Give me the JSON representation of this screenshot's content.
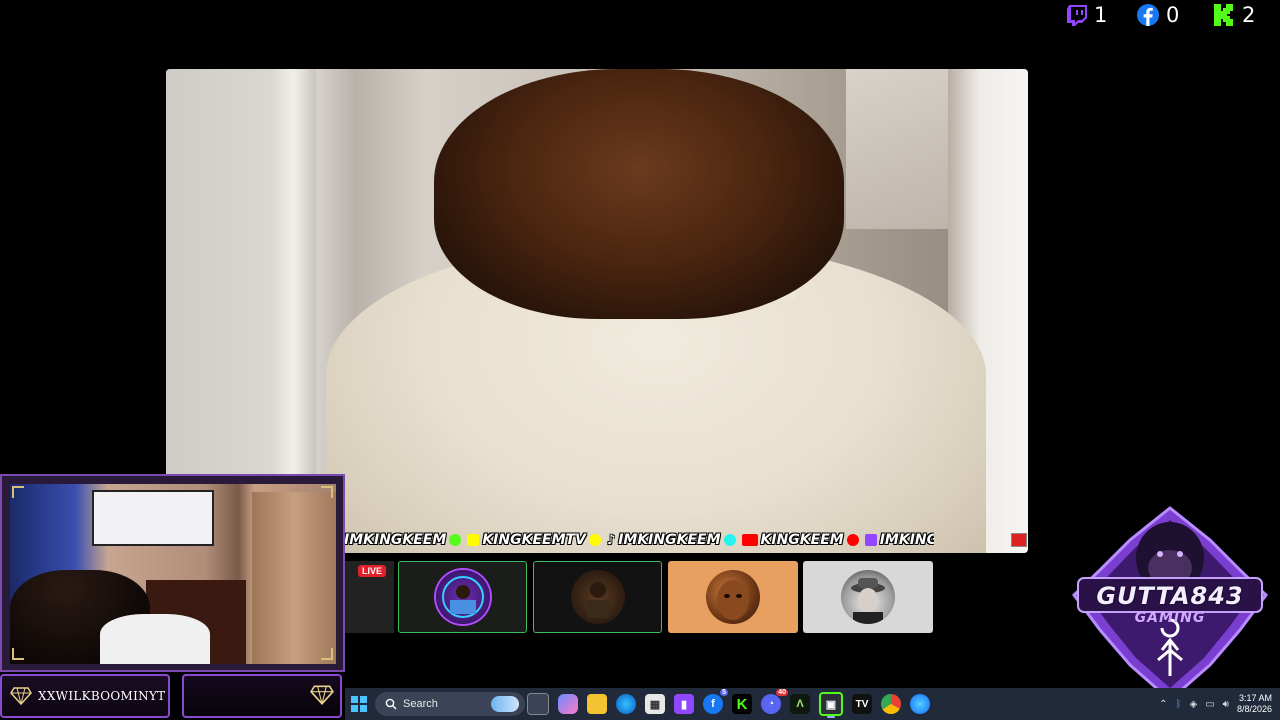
{
  "counters": [
    {
      "platform": "twitch",
      "icon": "twitch-icon",
      "count": "1"
    },
    {
      "platform": "facebook",
      "icon": "facebook-icon",
      "count": "0"
    },
    {
      "platform": "kick",
      "icon": "kick-icon",
      "count": "2"
    }
  ],
  "ticker": [
    {
      "icon": "kick-icon",
      "text": "IMKINGKEEM"
    },
    {
      "icon": "snapchat-icon",
      "text": "KINGKEEMTV"
    },
    {
      "icon": "tiktok-icon",
      "text": "IMKINGKEEM"
    },
    {
      "icon": "youtube-icon",
      "text": "KINGKEEM"
    },
    {
      "icon": "twitch-icon",
      "text": "IMKINGKEEM"
    }
  ],
  "live_badge": "LIVE",
  "webcam": {
    "name": "XXWILKBOOMINYT"
  },
  "logo": {
    "line1": "GUTTA843",
    "line2": "GAMING"
  },
  "taskbar": {
    "search_label": "Search",
    "clock_time": "3:17 AM",
    "clock_date": "8/8/2026",
    "discord_badge": "40",
    "facebook_badge": "5"
  },
  "colors": {
    "twitch": "#9146FF",
    "facebook": "#1877F2",
    "kick": "#53FC18",
    "thumb_border": "#3cbd5c",
    "webcam_border": "#8a4ad0"
  }
}
